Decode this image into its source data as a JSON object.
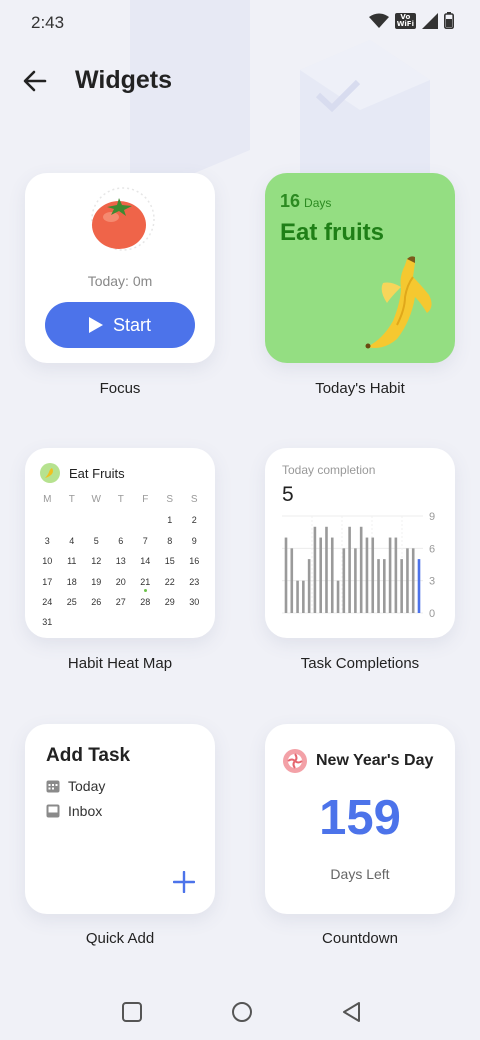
{
  "status_bar": {
    "time": "2:43",
    "vowifi_line1": "Vo",
    "vowifi_line2": "WiFi"
  },
  "header": {
    "title": "Widgets",
    "back_icon": "arrow-left-icon"
  },
  "widgets": {
    "focus": {
      "label": "Focus",
      "today_text": "Today: 0m",
      "start_label": "Start",
      "icon": "tomato-icon"
    },
    "habit": {
      "label": "Today's Habit",
      "days_count": "16",
      "days_unit": "Days",
      "habit_name": "Eat fruits",
      "icon": "banana-icon",
      "bg_color": "#94de82"
    },
    "heat_map": {
      "label": "Habit Heat Map",
      "title": "Eat Fruits",
      "weekdays": [
        "M",
        "T",
        "W",
        "T",
        "F",
        "S",
        "S"
      ],
      "weeks": [
        [
          "",
          "",
          "",
          "",
          "",
          "1",
          "2"
        ],
        [
          "3",
          "4",
          "5",
          "6",
          "7",
          "8",
          "9"
        ],
        [
          "10",
          "11",
          "12",
          "13",
          "14",
          "15",
          "16"
        ],
        [
          "17",
          "18",
          "19",
          "20",
          "21",
          "22",
          "23"
        ],
        [
          "24",
          "25",
          "26",
          "27",
          "28",
          "29",
          "30"
        ],
        [
          "31",
          "",
          "",
          "",
          "",
          "",
          ""
        ]
      ],
      "highlight_day": "21"
    },
    "task_completions": {
      "label": "Task Completions",
      "title": "Today completion",
      "value": "5"
    },
    "quick_add": {
      "label": "Quick Add",
      "title": "Add Task",
      "items": [
        "Today",
        "Inbox"
      ]
    },
    "countdown": {
      "label": "Countdown",
      "event": "New Year's Day",
      "days": "159",
      "sub": "Days Left"
    }
  },
  "chart_data": {
    "type": "bar",
    "title": "Today completion",
    "ylim": [
      0,
      9
    ],
    "yticks": [
      "9",
      "6",
      "3",
      "0"
    ],
    "series": [
      {
        "values": [
          7,
          6,
          3,
          3,
          5,
          8,
          7,
          8,
          7,
          3,
          6,
          8,
          6,
          8,
          7,
          7,
          5,
          5,
          7,
          7,
          5,
          6,
          6,
          5
        ]
      }
    ],
    "highlight_last_color": "#4c73ea",
    "bar_color": "#9a9a9a"
  },
  "nav_bar": {
    "icons": [
      "recents-square-icon",
      "home-circle-icon",
      "back-triangle-icon"
    ]
  }
}
